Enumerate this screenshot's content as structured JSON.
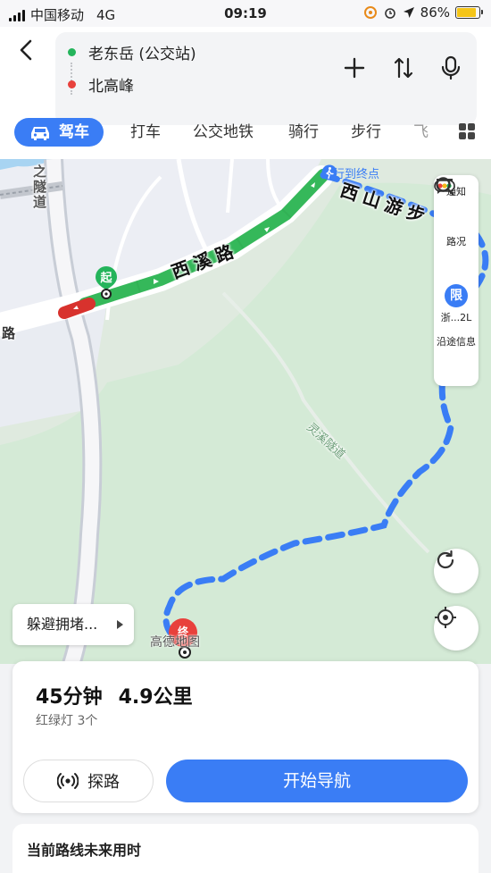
{
  "status_bar": {
    "carrier": "中国移动",
    "network": "4G",
    "time": "09:19",
    "battery": "86%",
    "battery_level": 0.86
  },
  "route": {
    "origin": "老东岳 (公交站)",
    "destination": "北高峰"
  },
  "tabs": [
    "驾车",
    "打车",
    "公交地铁",
    "骑行",
    "步行",
    "飞"
  ],
  "map": {
    "road_label_1": "西溪路",
    "road_label_2": "西山游步",
    "tunnel_label": "之隧道",
    "tunnel_small": "灵溪隧道",
    "road_edge": "路",
    "walk_to_end": "步行到终点",
    "start_marker": "起",
    "end_marker": "终",
    "watermark": "高德地图"
  },
  "side_panel": {
    "notice": "通知",
    "traffic": "路况",
    "restrict_badge": "限",
    "restrict_label": "浙...2L",
    "along_info": "沿途信息"
  },
  "avoid_jam": "躲避拥堵...",
  "summary": {
    "duration": "45分钟",
    "distance": "4.9公里",
    "lights": "红绿灯 3个",
    "explore": "探路",
    "start_nav": "开始导航"
  },
  "future_time": "当前路线未来用时",
  "colors": {
    "accent": "#3a7df5",
    "route_green": "#35b85a",
    "jam_red": "#e8413c"
  }
}
